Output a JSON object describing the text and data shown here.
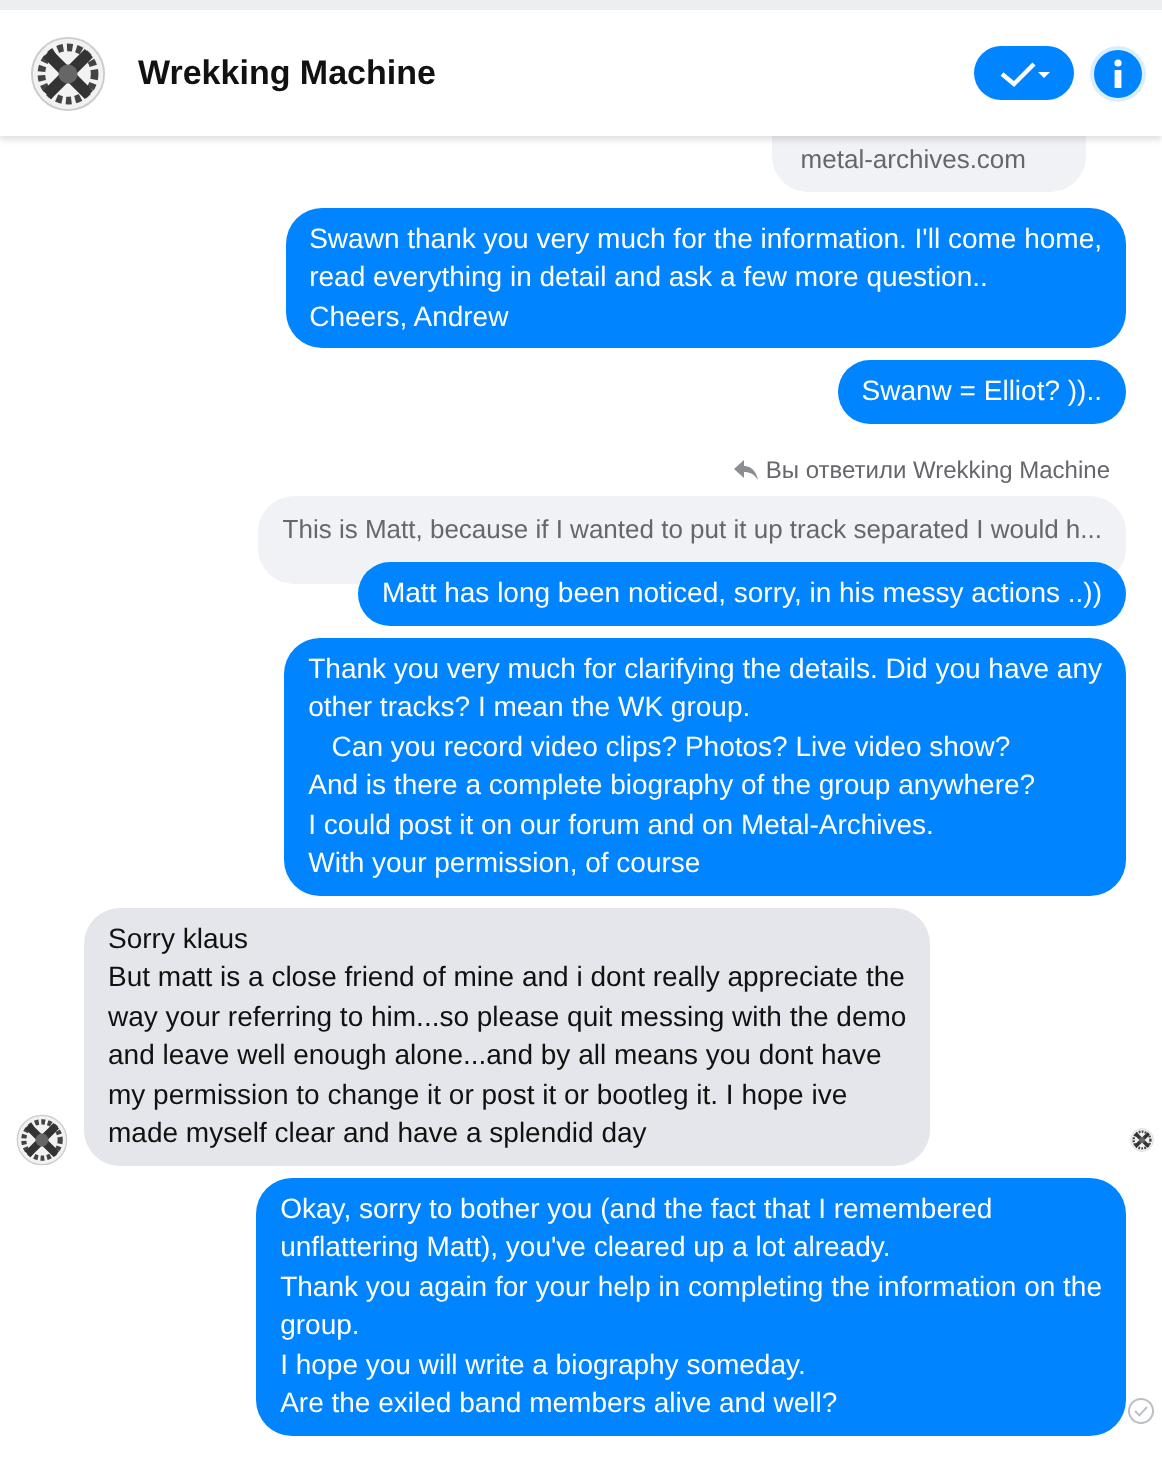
{
  "header": {
    "title": "Wrekking Machine"
  },
  "messages": [
    {
      "kind": "quoted_top",
      "text": "metal-archives.com"
    },
    {
      "kind": "outgoing",
      "text": "Swawn thank you very much for the information. I'll come home,\nread everything in detail and ask a few more question..\nCheers, Andrew"
    },
    {
      "kind": "outgoing",
      "text": "Swanw = Elliot? )).."
    },
    {
      "kind": "reply_note",
      "text": "Вы ответили Wrekking Machine"
    },
    {
      "kind": "quoted",
      "text": "This is Matt, because if I wanted to put it up track separated I would h..."
    },
    {
      "kind": "outgoing",
      "text": "Matt has long been noticed, sorry, in his messy actions ..))"
    },
    {
      "kind": "outgoing",
      "text": "Thank you very much for clarifying the details. Did you have any\nother tracks? I mean the WK group.\n   Can you record video clips? Photos? Live video show?\nAnd is there a complete biography of the group anywhere?\nI could post it on our forum and on Metal-Archives.\nWith your permission, of course"
    },
    {
      "kind": "incoming",
      "text": "Sorry klaus\nBut matt is a close friend of mine and i dont really appreciate the\nway your referring to him...so please quit messing with the demo\nand leave well enough alone...and by all means you dont have\nmy permission to change it or post it or bootleg it. I hope ive\nmade myself clear and have a splendid day"
    },
    {
      "kind": "outgoing",
      "text": "Okay, sorry to bother you (and the fact that I remembered\nunflattering Matt), you've cleared up a lot already.\nThank you again for your help in completing the information on the\ngroup.\nI hope you will write a biography someday.\nAre the exiled band members alive and well?"
    }
  ]
}
